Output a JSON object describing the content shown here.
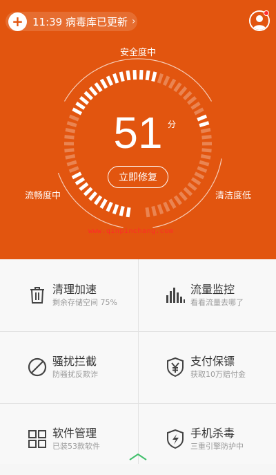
{
  "status": {
    "text": "11:39 病毒库已更新",
    "plus_icon": "plus-icon",
    "chevron": "›"
  },
  "profile": {
    "icon": "user-avatar-icon",
    "badge_color": "#ff2d2d"
  },
  "gauge": {
    "score": "51",
    "unit": "分",
    "top_label": "安全度中",
    "left_label": "流畅度中",
    "right_label": "清洁度低",
    "repair_button": "立即修复",
    "outer_ring_fill": 0.62,
    "inner_ring_fill": 0.55
  },
  "watermark": "www.qinpinchang.com",
  "colors": {
    "accent": "#e2550f",
    "watermark": "#ff2a2a"
  },
  "features": [
    {
      "title": "清理加速",
      "subtitle": "剩余存储空间 75%",
      "icon": "trash-icon"
    },
    {
      "title": "流量监控",
      "subtitle": "看看流量去哪了",
      "icon": "bars-icon"
    },
    {
      "title": "骚扰拦截",
      "subtitle": "防骚扰反欺诈",
      "icon": "block-icon"
    },
    {
      "title": "支付保镖",
      "subtitle": "获取10万赔付金",
      "icon": "yen-shield-icon"
    },
    {
      "title": "软件管理",
      "subtitle": "已装53款软件",
      "icon": "apps-grid-icon"
    },
    {
      "title": "手机杀毒",
      "subtitle": "三重引擎防护中",
      "icon": "bolt-shield-icon"
    }
  ]
}
